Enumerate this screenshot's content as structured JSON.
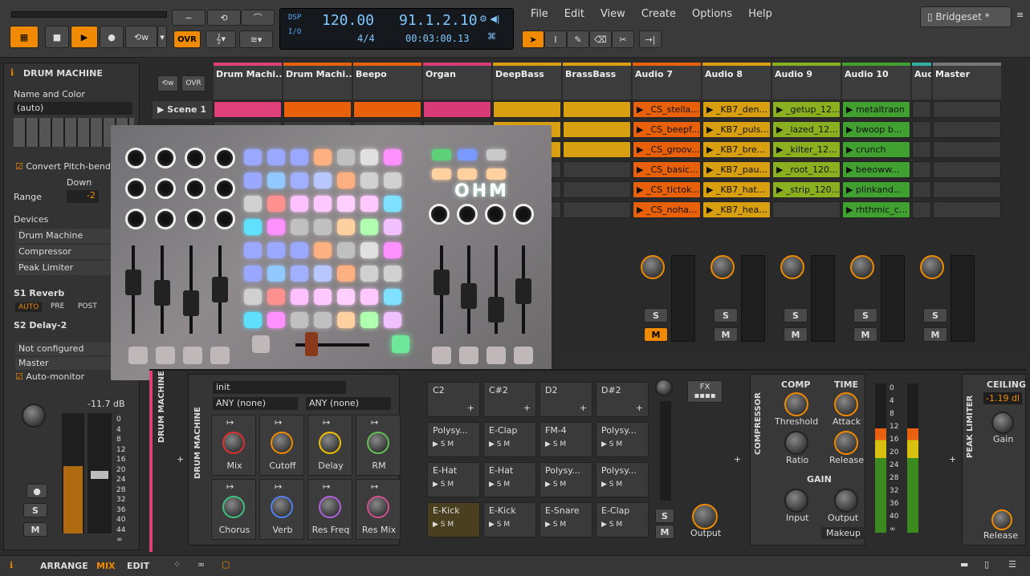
{
  "transport": {
    "tempo": "120.00",
    "position": "91.1.2.10",
    "signature": "4/4",
    "time": "00:03:00.13",
    "dsp": "DSP",
    "io": "I/O",
    "ovr": "OVR"
  },
  "menu": [
    "File",
    "Edit",
    "View",
    "Create",
    "Options",
    "Help"
  ],
  "project_tab": "Bridgeset *",
  "left": {
    "title": "DRUM MACHINE",
    "name_color": "Name and Color",
    "name_value": "(auto)",
    "convert": "Convert Pitch-bend",
    "down": "Down",
    "range": "Range",
    "range_value": "-2",
    "devices_label": "Devices",
    "devices": [
      "Drum Machine",
      "Compressor",
      "Peak Limiter"
    ],
    "send1": "S1 Reverb",
    "send2": "S2 Delay-2",
    "auto": "AUTO",
    "pre": "PRE",
    "post": "POST",
    "notconf": "Not configured",
    "master": "Master",
    "automonitor": "Auto-monitor",
    "db": "-11.7 dB",
    "scale": [
      "0",
      "4",
      "8",
      "12",
      "16",
      "20",
      "24",
      "28",
      "32",
      "36",
      "40",
      "44",
      "∞"
    ],
    "s": "S",
    "m": "M"
  },
  "mixer": {
    "scene": "Scene 1",
    "tracks": [
      {
        "name": "Drum Machi...",
        "color": "#e0407a"
      },
      {
        "name": "Drum Machi...",
        "color": "#e8600a"
      },
      {
        "name": "Beepo",
        "color": "#e8600a"
      },
      {
        "name": "Organ",
        "color": "#d83a78"
      },
      {
        "name": "DeepBass",
        "color": "#d8a010"
      },
      {
        "name": "BrassBass",
        "color": "#d8a010"
      },
      {
        "name": "Audio 7",
        "color": "#e8600a"
      },
      {
        "name": "Audio 8",
        "color": "#d8a010"
      },
      {
        "name": "Audio 9",
        "color": "#8ab020"
      },
      {
        "name": "Audio 10",
        "color": "#40a030"
      },
      {
        "name": "Aud",
        "color": "#30b0a0"
      },
      {
        "name": "Master",
        "color": "#777777"
      }
    ],
    "clips7": [
      "_CS_stella...",
      "_CS_beepf...",
      "_CS_groov...",
      "_CS_basic...",
      "_CS_tictok...",
      "_CS_noha..."
    ],
    "clips8": [
      "_KB7_den...",
      "_KB7_puls...",
      "_KB7_bre...",
      "_KB7_pau...",
      "_KB7_hat...",
      "_KB7_hea..."
    ],
    "clips9": [
      "_getup_12...",
      "_lazed_12...",
      "_kilter_12...",
      "_root_120...",
      "_strip_120..."
    ],
    "clips10": [
      "metaltraon",
      "bwoop b...",
      "crunch",
      "beeoww...",
      "plinkand...",
      "rhthmic_c..."
    ]
  },
  "controller": {
    "logo": "OHM"
  },
  "device": {
    "title": "DRUM MACHINE",
    "preset": "init",
    "any1": "ANY (none)",
    "any2": "ANY (none)",
    "macros": [
      "Mix",
      "Cutoff",
      "Delay",
      "RM",
      "Chorus",
      "Verb",
      "Res Freq",
      "Res Mix"
    ],
    "pads": [
      {
        "note": "C2",
        "name": ""
      },
      {
        "note": "C#2",
        "name": ""
      },
      {
        "note": "D2",
        "name": ""
      },
      {
        "note": "D#2",
        "name": ""
      },
      {
        "note": "",
        "name": "Polysy..."
      },
      {
        "note": "",
        "name": "E-Clap"
      },
      {
        "note": "",
        "name": "FM-4"
      },
      {
        "note": "",
        "name": "Polysy..."
      },
      {
        "note": "",
        "name": "E-Hat"
      },
      {
        "note": "",
        "name": "E-Hat"
      },
      {
        "note": "",
        "name": "Polysy..."
      },
      {
        "note": "",
        "name": "Polysy..."
      },
      {
        "note": "",
        "name": "E-Kick"
      },
      {
        "note": "",
        "name": "E-Kick"
      },
      {
        "note": "",
        "name": "E-Snare"
      },
      {
        "note": "",
        "name": "E-Clap"
      }
    ],
    "fx": "FX",
    "output": "Output",
    "s": "S",
    "m": "M",
    "comp": {
      "title": "COMPRESSOR",
      "comp": "COMP",
      "time": "TIME",
      "threshold": "Threshold",
      "attack": "Attack",
      "ratio": "Ratio",
      "release": "Release",
      "gain": "GAIN",
      "input": "Input",
      "output": "Output",
      "makeup": "Makeup"
    },
    "meter_scale": [
      "0",
      "4",
      "8",
      "12",
      "16",
      "20",
      "24",
      "28",
      "32",
      "36",
      "40",
      "∞"
    ],
    "limiter": {
      "title": "PEAK LIMITER",
      "ceiling": "CEILING",
      "ceiling_value": "-1.19 dl",
      "gain": "Gain",
      "release": "Release"
    }
  },
  "bottom": {
    "arrange": "ARRANGE",
    "mix": "MIX",
    "edit": "EDIT"
  },
  "colors": {
    "accent": "#f08a00",
    "active": "#e8a030"
  }
}
